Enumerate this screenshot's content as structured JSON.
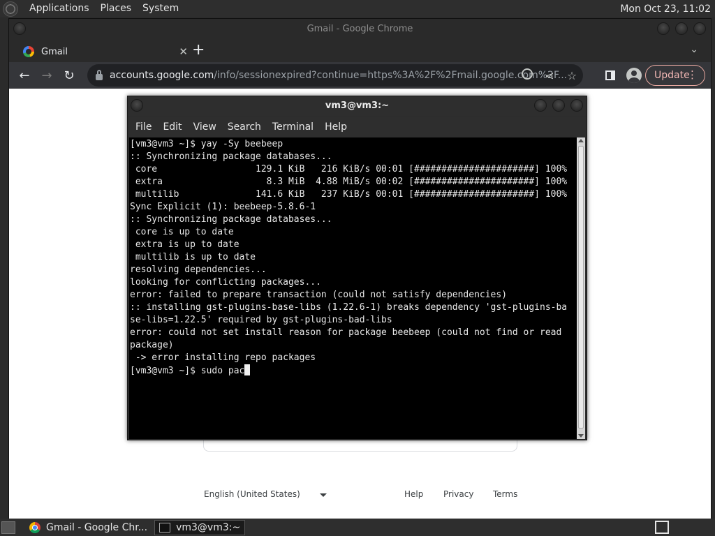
{
  "panel": {
    "menus": [
      "Applications",
      "Places",
      "System"
    ],
    "clock": "Mon Oct 23, 11:02"
  },
  "chrome": {
    "window_title": "Gmail - Google Chrome",
    "tab_title": "Gmail",
    "url_host": "accounts.google.com",
    "url_path": "/info/sessionexpired?continue=https%3A%2F%2Fmail.google.com%2F...",
    "update_label": "Update",
    "footer": {
      "language": "English (United States)",
      "help": "Help",
      "privacy": "Privacy",
      "terms": "Terms"
    }
  },
  "terminal": {
    "title": "vm3@vm3:~",
    "menu": [
      "File",
      "Edit",
      "View",
      "Search",
      "Terminal",
      "Help"
    ],
    "lines": [
      "[vm3@vm3 ~]$ yay -Sy beebeep",
      ":: Synchronizing package databases...",
      " core                  129.1 KiB   216 KiB/s 00:01 [######################] 100%",
      " extra                   8.3 MiB  4.88 MiB/s 00:02 [######################] 100%",
      " multilib              141.6 KiB   237 KiB/s 00:01 [######################] 100%",
      "Sync Explicit (1): beebeep-5.8.6-1",
      ":: Synchronizing package databases...",
      " core is up to date",
      " extra is up to date",
      " multilib is up to date",
      "resolving dependencies...",
      "looking for conflicting packages...",
      "error: failed to prepare transaction (could not satisfy dependencies)",
      ":: installing gst-plugins-base-libs (1.22.6-1) breaks dependency 'gst-plugins-ba",
      "se-libs=1.22.5' required by gst-plugins-bad-libs",
      "error: could not set install reason for package beebeep (could not find or read",
      "package)",
      " -> error installing repo packages"
    ],
    "prompt": "[vm3@vm3 ~]$ sudo pac"
  },
  "taskbar": {
    "items": [
      "Gmail - Google Chr...",
      "vm3@vm3:~"
    ]
  }
}
